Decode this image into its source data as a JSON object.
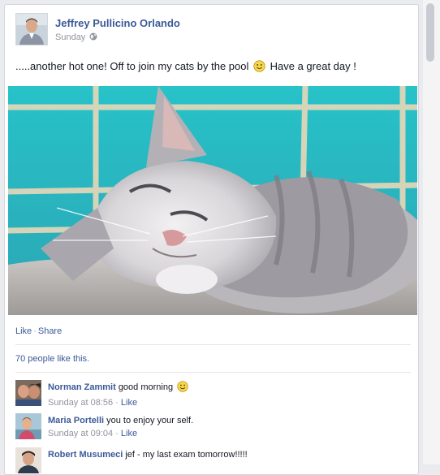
{
  "post": {
    "author": "Jeffrey Pullicino Orlando",
    "time": "Sunday",
    "text_before": ".....another hot one! Off to join my cats by the pool",
    "text_after": "Have a great day !"
  },
  "actions": {
    "like": "Like",
    "separator": "·",
    "share": "Share"
  },
  "likes_summary": "70 people like this.",
  "comments": [
    {
      "name": "Norman Zammit",
      "text": "good morning",
      "has_smiley": true,
      "time": "Sunday at 08:56",
      "like": "Like"
    },
    {
      "name": "Maria Portelli",
      "text": "you to enjoy your self.",
      "has_smiley": false,
      "time": "Sunday at 09:04",
      "like": "Like"
    },
    {
      "name": "Robert Musumeci",
      "text": "jef - my last exam tomorrow!!!!!",
      "has_smiley": false,
      "time": "",
      "like": ""
    }
  ],
  "colors": {
    "link": "#3b5998",
    "meta": "#90949c",
    "border": "#d3d6db",
    "background": "#e9ebee"
  },
  "icons": [
    "globe-icon",
    "smiley-icon"
  ]
}
